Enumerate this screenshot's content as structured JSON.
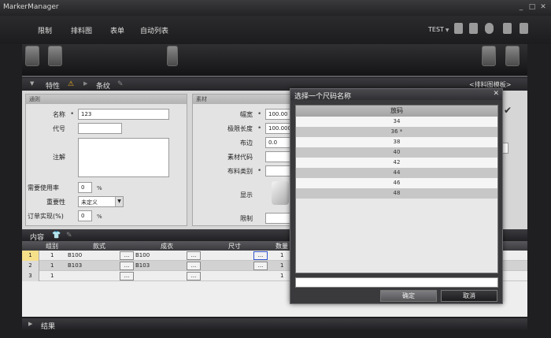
{
  "app": {
    "title": "MarkerManager"
  },
  "window_controls": [
    "_",
    "□",
    "✕"
  ],
  "menu": {
    "items": [
      "限制",
      "排料图",
      "表单",
      "自动列表"
    ]
  },
  "user": {
    "name": "TEST"
  },
  "panel": {
    "tabs": [
      "特性",
      "条纹"
    ],
    "template_label": "<排料图模板>"
  },
  "general_group": {
    "title": "通则",
    "name_label": "名称",
    "name_value": "123",
    "code_label": "代号",
    "code_value": "",
    "notes_label": "注解",
    "notes_value": "",
    "usage_label": "需要使用率",
    "usage_value": "0",
    "usage_unit": "%",
    "priority_label": "重要性",
    "priority_value": "未定义",
    "order_label": "订单实现(%)",
    "order_value": "0",
    "order_unit": "%"
  },
  "material_group": {
    "title": "素材",
    "width_label": "幅宽",
    "width_value": "100.00",
    "max_length_label": "极限长度",
    "max_length_value": "100.000",
    "edge_label": "布边",
    "edge_value": "0.0",
    "material_code_label": "素材代码",
    "material_code_value": "",
    "fabric_type_label": "布料类别",
    "fabric_type_value": "",
    "display_label": "显示",
    "limit_label": "限制",
    "limit_value": ""
  },
  "content": {
    "title": "内容"
  },
  "table": {
    "columns": [
      "组别",
      "款式",
      "成衣",
      "尺寸",
      "数量"
    ],
    "rows": [
      {
        "num": "1",
        "group": "1",
        "style": "B100",
        "garment": "B100",
        "size": "",
        "qty": "1"
      },
      {
        "num": "2",
        "group": "1",
        "style": "B103",
        "garment": "B103",
        "size": "",
        "qty": "1"
      },
      {
        "num": "3",
        "group": "1",
        "style": "",
        "garment": "",
        "size": "",
        "qty": "1"
      }
    ],
    "dots": "..."
  },
  "results": {
    "title": "结果"
  },
  "dialog": {
    "title": "选择一个尺码名称",
    "close": "✕",
    "column_header": "放码",
    "sizes": [
      "34",
      "36 *",
      "38",
      "40",
      "42",
      "44",
      "46",
      "48"
    ],
    "input_value": "",
    "ok_label": "确定",
    "cancel_label": "取消"
  },
  "colors": {
    "background": "#1f1f21",
    "dialog": "#3a3a3d",
    "selected_row": "#f6e08a"
  }
}
